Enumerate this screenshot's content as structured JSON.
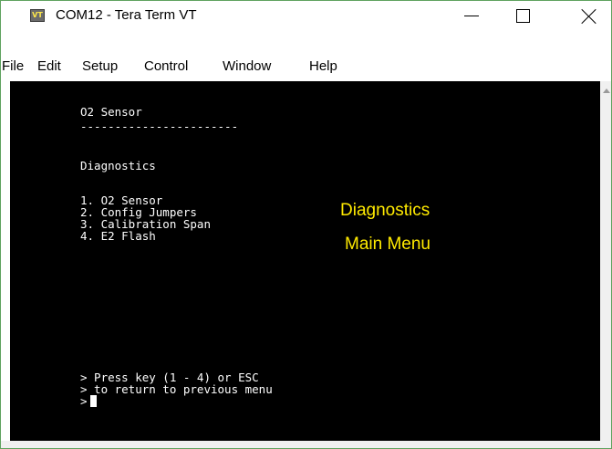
{
  "window": {
    "title": "COM12 - Tera Term VT",
    "app_icon_text": "VT"
  },
  "menu": {
    "items": [
      "File",
      "Edit",
      "Setup",
      "Control",
      "Window",
      "Help"
    ]
  },
  "terminal": {
    "lines": [
      "O2 Sensor",
      "-----------------------",
      "Diagnostics",
      "1. O2 Sensor",
      "2. Config Jumpers",
      "3. Calibration Span",
      "4. E2 Flash",
      "> Press key (1 - 4) or ESC",
      "> to return to previous menu",
      ">"
    ]
  },
  "annotation": {
    "line1": "Diagnostics",
    "line2": "Main Menu",
    "color": "#ffea00"
  },
  "colors": {
    "terminal_bg": "#000000",
    "terminal_fg": "#ffffff",
    "window_border": "#5fa35f"
  },
  "icons": {
    "app": "tera-term-icon",
    "minimize": "minimize-icon",
    "maximize": "maximize-icon",
    "close": "close-icon",
    "scroll_up": "scroll-up-arrow-icon"
  }
}
